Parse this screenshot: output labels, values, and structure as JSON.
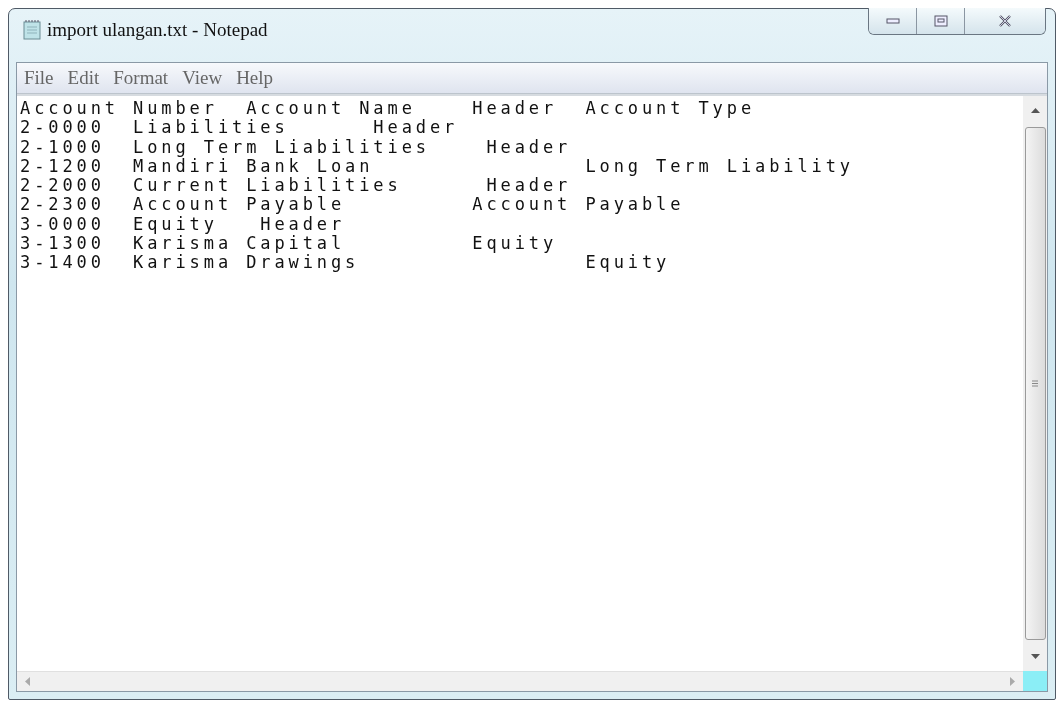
{
  "window": {
    "title": "import ulangan.txt - Notepad"
  },
  "menu": [
    "File",
    "Edit",
    "Format",
    "View",
    "Help"
  ],
  "document": {
    "lines": [
      "Account Number  Account Name    Header  Account Type",
      "2-0000  Liabilities      Header",
      "2-1000  Long Term Liabilities    Header",
      "2-1200  Mandiri Bank Loan               Long Term Liability",
      "2-2000  Current Liabilities      Header",
      "2-2300  Account Payable         Account Payable",
      "3-0000  Equity   Header",
      "3-1300  Karisma Capital         Equity",
      "3-1400  Karisma Drawings                Equity"
    ]
  }
}
